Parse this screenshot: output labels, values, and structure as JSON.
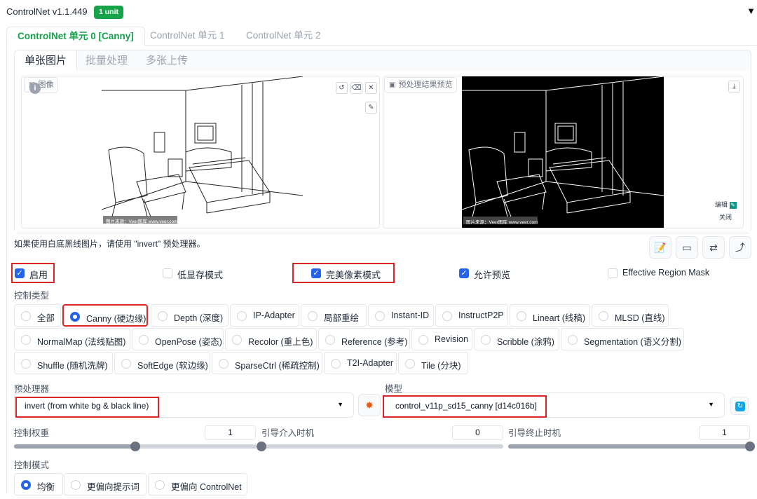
{
  "header": {
    "title": "ControlNet v1.1.449",
    "badge": "1 unit",
    "collapse_icon": "triangle-down-icon"
  },
  "unit_tabs": [
    {
      "label": "ControlNet 单元 0 [Canny]",
      "active": true
    },
    {
      "label": "ControlNet 单元 1",
      "active": false
    },
    {
      "label": "ControlNet 单元 2",
      "active": false
    }
  ],
  "image_tabs": [
    {
      "label": "单张图片",
      "active": true
    },
    {
      "label": "批量处理",
      "active": false
    },
    {
      "label": "多张上传",
      "active": false
    }
  ],
  "input_image": {
    "label": "图像",
    "watermark": "图片来源：Veer图库 www.veer.com"
  },
  "preview_image": {
    "label": "预处理结果预览",
    "watermark": "图片来源：Veer图库 www.veer.com",
    "edit_label": "编辑",
    "close_label": "关闭"
  },
  "hint": "如果使用白底黑线图片，请使用 \"invert\" 预处理器。",
  "checkboxes": [
    {
      "label": "启用",
      "checked": true
    },
    {
      "label": "低显存模式",
      "checked": false
    },
    {
      "label": "完美像素模式",
      "checked": true
    },
    {
      "label": "允许预览",
      "checked": true
    },
    {
      "label": "Effective Region Mask",
      "checked": false
    }
  ],
  "control_type": {
    "label": "控制类型",
    "rows": [
      [
        "全部",
        "Canny (硬边缘)",
        "Depth (深度)",
        "IP-Adapter",
        "局部重绘",
        "Instant-ID",
        "InstructP2P",
        "Lineart (线稿)",
        "MLSD (直线)"
      ],
      [
        "NormalMap (法线贴图)",
        "OpenPose (姿态)",
        "Recolor (重上色)",
        "Reference (参考)",
        "Revision",
        "Scribble (涂鸦)",
        "Segmentation (语义分割)"
      ],
      [
        "Shuffle (随机洗牌)",
        "SoftEdge (软边缘)",
        "SparseCtrl (稀疏控制)",
        "T2I-Adapter",
        "Tile (分块)"
      ]
    ],
    "selected": "Canny (硬边缘)"
  },
  "preprocessor": {
    "label": "预处理器",
    "value": "invert (from white bg & black line)"
  },
  "model": {
    "label": "模型",
    "value": "control_v11p_sd15_canny [d14c016b]"
  },
  "sliders": [
    {
      "label": "控制权重",
      "value": "1",
      "fraction": 0.5
    },
    {
      "label": "引导介入时机",
      "value": "0",
      "fraction": 0.0
    },
    {
      "label": "引导终止时机",
      "value": "1",
      "fraction": 1.0
    }
  ],
  "control_mode": {
    "label": "控制模式",
    "options": [
      "均衡",
      "更偏向提示词",
      "更偏向 ControlNet"
    ],
    "selected": "均衡"
  },
  "colors": {
    "accent": "#2563eb",
    "brand_green": "#16a34a",
    "highlight": "#dc2626"
  }
}
